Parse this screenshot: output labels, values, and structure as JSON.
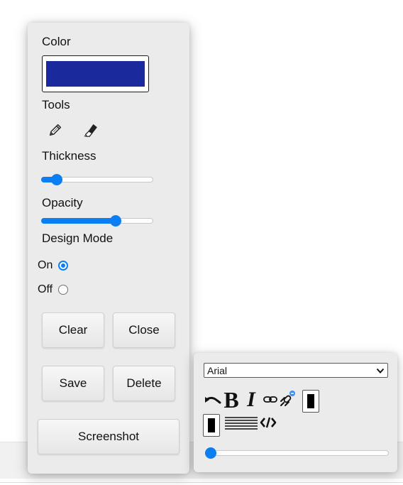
{
  "drawing_panel": {
    "color_label": "Color",
    "current_color": "#1a2a9c",
    "tools_label": "Tools",
    "tools": [
      "pencil-icon",
      "eraser-icon"
    ],
    "thickness_label": "Thickness",
    "thickness_value_pct": 10,
    "opacity_label": "Opacity",
    "opacity_value_pct": 68,
    "design_mode_label": "Design Mode",
    "design_mode_options": [
      {
        "label": "On",
        "checked": true
      },
      {
        "label": "Off",
        "checked": false
      }
    ],
    "buttons": {
      "clear": "Clear",
      "close": "Close",
      "save": "Save",
      "delete": "Delete",
      "screenshot": "Screenshot"
    }
  },
  "text_toolbar": {
    "font_family": "Arial",
    "buttons": [
      "undo-icon",
      "bold-button",
      "italic-button",
      "link-icon",
      "unlink-icon",
      "text-color",
      "background-color",
      "justify-icon",
      "code-icon"
    ],
    "text_color": "#000000",
    "background_color": "#000000",
    "size_value_pct": 0
  },
  "accent_color": "#0b7ff2"
}
